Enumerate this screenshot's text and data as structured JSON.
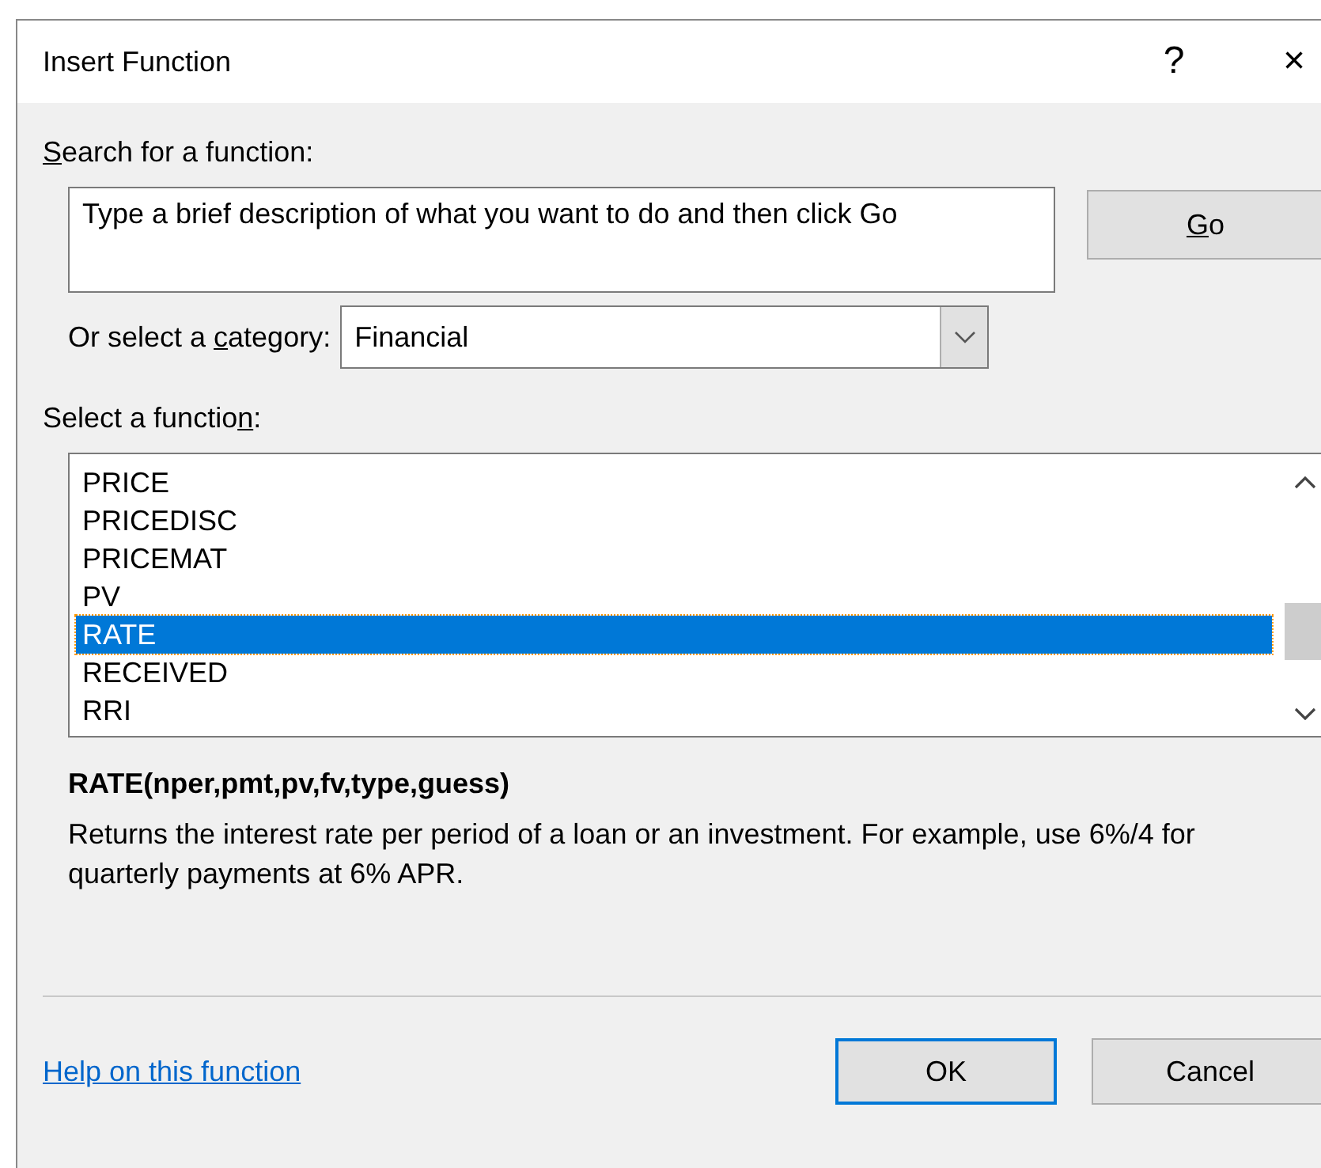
{
  "window": {
    "title": "Insert Function",
    "help_glyph": "?",
    "close_glyph": "×"
  },
  "search": {
    "label": {
      "key": "S",
      "after": "earch for a function:"
    },
    "value": "Type a brief description of what you want to do and then click Go",
    "go_button": {
      "key": "G",
      "after": "o"
    }
  },
  "category": {
    "label": {
      "before": "Or select a ",
      "key": "c",
      "after": "ategory:"
    },
    "value": "Financial"
  },
  "function_list": {
    "label": {
      "before": "Select a functio",
      "key": "n",
      "after": ":"
    },
    "items": [
      {
        "label": "PRICE",
        "selected": false
      },
      {
        "label": "PRICEDISC",
        "selected": false
      },
      {
        "label": "PRICEMAT",
        "selected": false
      },
      {
        "label": "PV",
        "selected": false
      },
      {
        "label": "RATE",
        "selected": true
      },
      {
        "label": "RECEIVED",
        "selected": false
      },
      {
        "label": "RRI",
        "selected": false
      }
    ]
  },
  "signature": "RATE(nper,pmt,pv,fv,type,guess)",
  "description": "Returns the interest rate per period of a loan or an investment. For example, use 6%/4 for quarterly payments at 6% APR.",
  "help_link": "Help on this function",
  "buttons": [
    {
      "label": "OK",
      "default": true
    },
    {
      "label": "Cancel",
      "default": false
    }
  ]
}
